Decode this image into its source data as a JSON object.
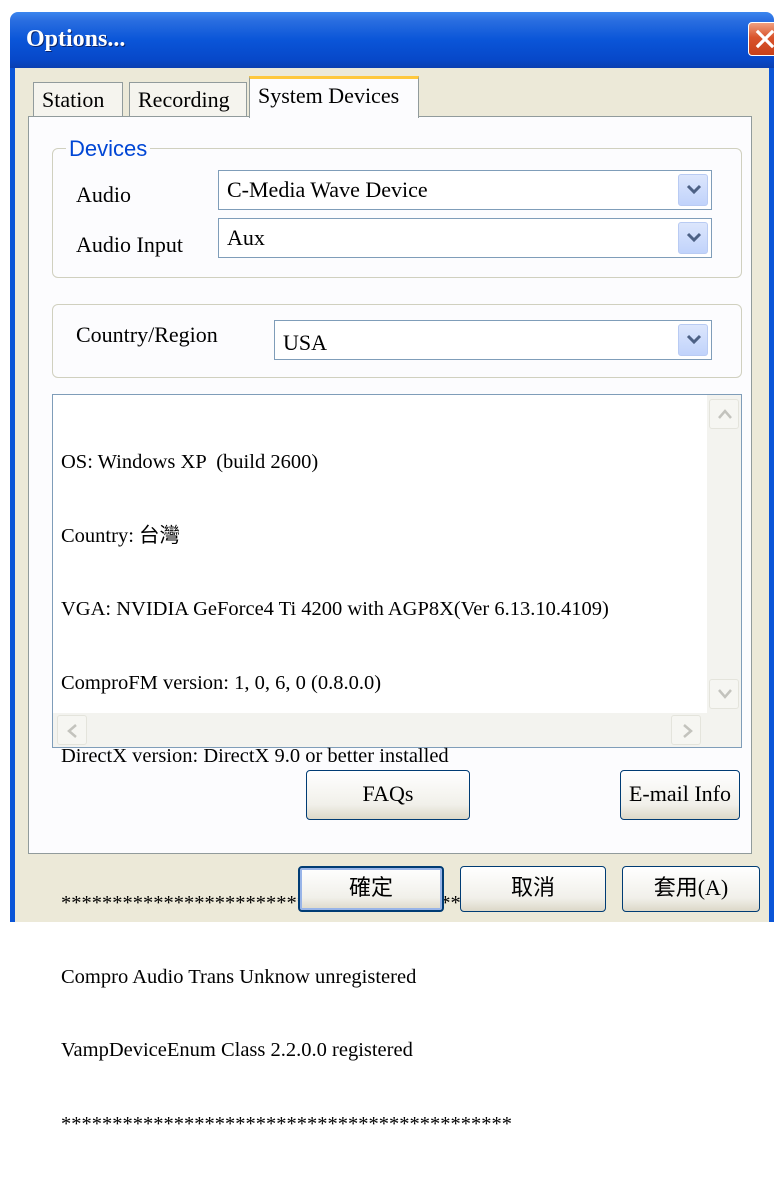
{
  "window": {
    "title": "Options..."
  },
  "tabs": [
    {
      "label": "Station"
    },
    {
      "label": "Recording"
    },
    {
      "label": "System Devices"
    }
  ],
  "devices_group": {
    "legend": "Devices",
    "audio": {
      "label": "Audio",
      "value": "C-Media Wave Device"
    },
    "audio_input": {
      "label": "Audio Input",
      "value": "Aux"
    }
  },
  "region_group": {
    "label": "Country/Region",
    "value": "USA"
  },
  "info": {
    "lines": [
      "OS: Windows XP  (build 2600)",
      "Country: 台灣",
      "VGA: NVIDIA GeForce4 Ti 4200 with AGP8X(Ver 6.13.10.4109)",
      "ComproFM version: 1, 0, 6, 0 (0.8.0.0)",
      "DirectX version: DirectX 9.0 or better installed",
      "",
      "********************************************",
      "Compro Audio Trans Unknow unregistered",
      "VampDeviceEnum Class 2.2.0.0 registered",
      "********************************************"
    ]
  },
  "buttons": {
    "faqs": "FAQs",
    "email": "E-mail Info",
    "ok": "確定",
    "cancel": "取消",
    "apply": "套用(A)"
  }
}
